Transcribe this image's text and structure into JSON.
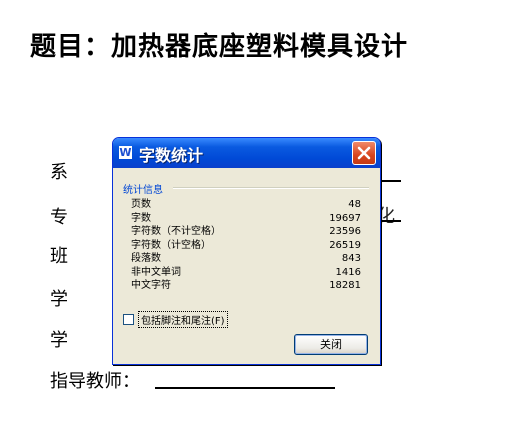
{
  "document": {
    "title": "题目：加热器底座塑料模具设计",
    "fields": [
      "系",
      "专",
      "班",
      "学",
      "学"
    ],
    "advisor_label": "指导教师：",
    "peek_char": "化"
  },
  "dialog": {
    "title": "字数统计",
    "app_icon": "W",
    "group_label": "统计信息",
    "stats": [
      {
        "label": "页数",
        "value": "48"
      },
      {
        "label": "字数",
        "value": "19697"
      },
      {
        "label": "字符数（不计空格）",
        "value": "23596"
      },
      {
        "label": "字符数（计空格）",
        "value": "26519"
      },
      {
        "label": "段落数",
        "value": "843"
      },
      {
        "label": "非中文单词",
        "value": "1416"
      },
      {
        "label": "中文字符",
        "value": "18281"
      }
    ],
    "checkbox_label": "包括脚注和尾注(F)",
    "checkbox_checked": false,
    "close_button": "关闭"
  },
  "icons": {
    "app": "word-icon",
    "close": "close-icon"
  },
  "colors": {
    "titlebar": "#0a5ae0",
    "dialog_bg": "#ece9d8",
    "close_button": "#d8451e",
    "group_label": "#0046d5"
  }
}
